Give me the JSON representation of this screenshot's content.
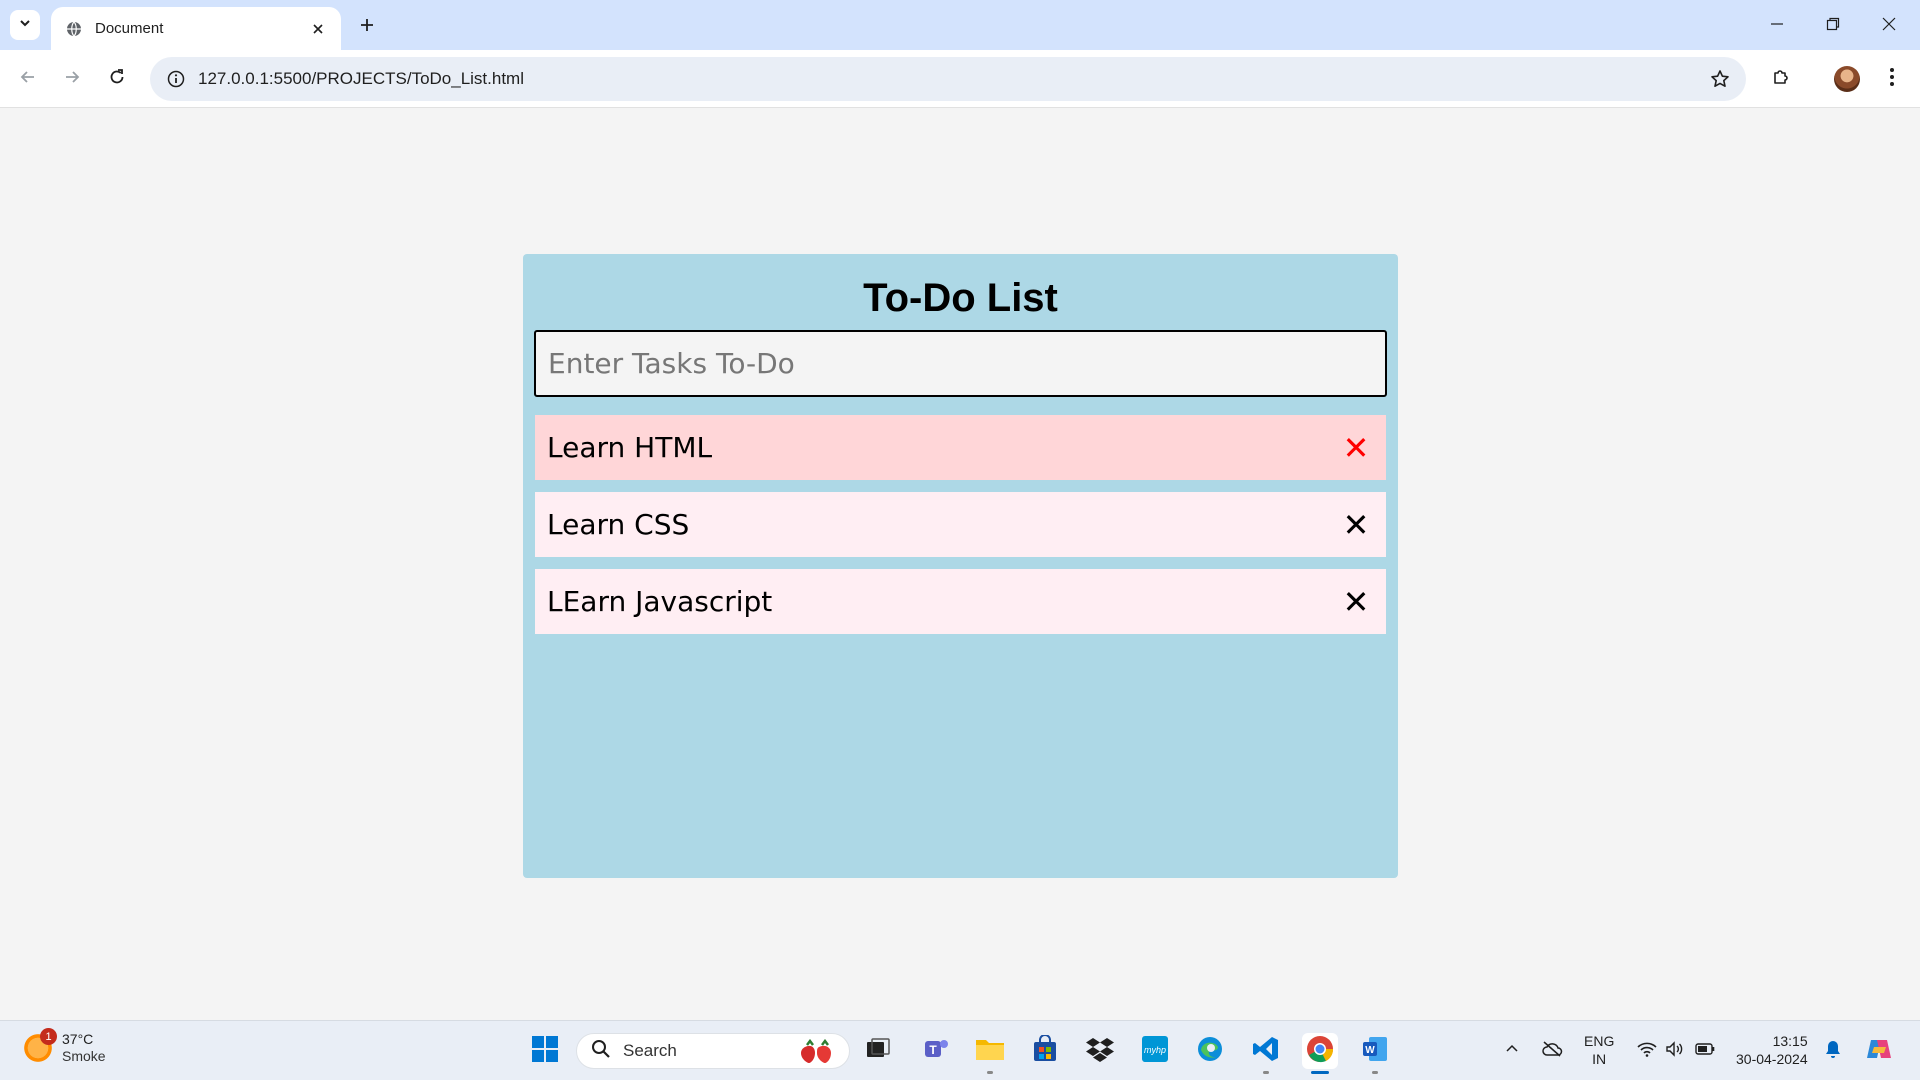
{
  "browser": {
    "tab_title": "Document",
    "url": "127.0.0.1:5500/PROJECTS/ToDo_List.html"
  },
  "todo": {
    "title": "To-Do List",
    "input_placeholder": "Enter Tasks To-Do",
    "input_value": "",
    "tasks": [
      {
        "label": "Learn HTML",
        "delete_symbol": "✕",
        "hovered": true
      },
      {
        "label": "Learn CSS",
        "delete_symbol": "✕",
        "hovered": false
      },
      {
        "label": "LEarn Javascript",
        "delete_symbol": "✕",
        "hovered": false
      }
    ],
    "colors": {
      "card_background": "#add8e6",
      "page_background": "#f4f4f4",
      "task_background": "#ffeef3",
      "task_hover_background": "#ffd6d8",
      "delete_hover_color": "#ff0000"
    }
  },
  "taskbar": {
    "weather_temp": "37°C",
    "weather_desc": "Smoke",
    "weather_badge": "1",
    "search_label": "Search",
    "lang_line1": "ENG",
    "lang_line2": "IN",
    "time": "13:15",
    "date": "30-04-2024"
  }
}
